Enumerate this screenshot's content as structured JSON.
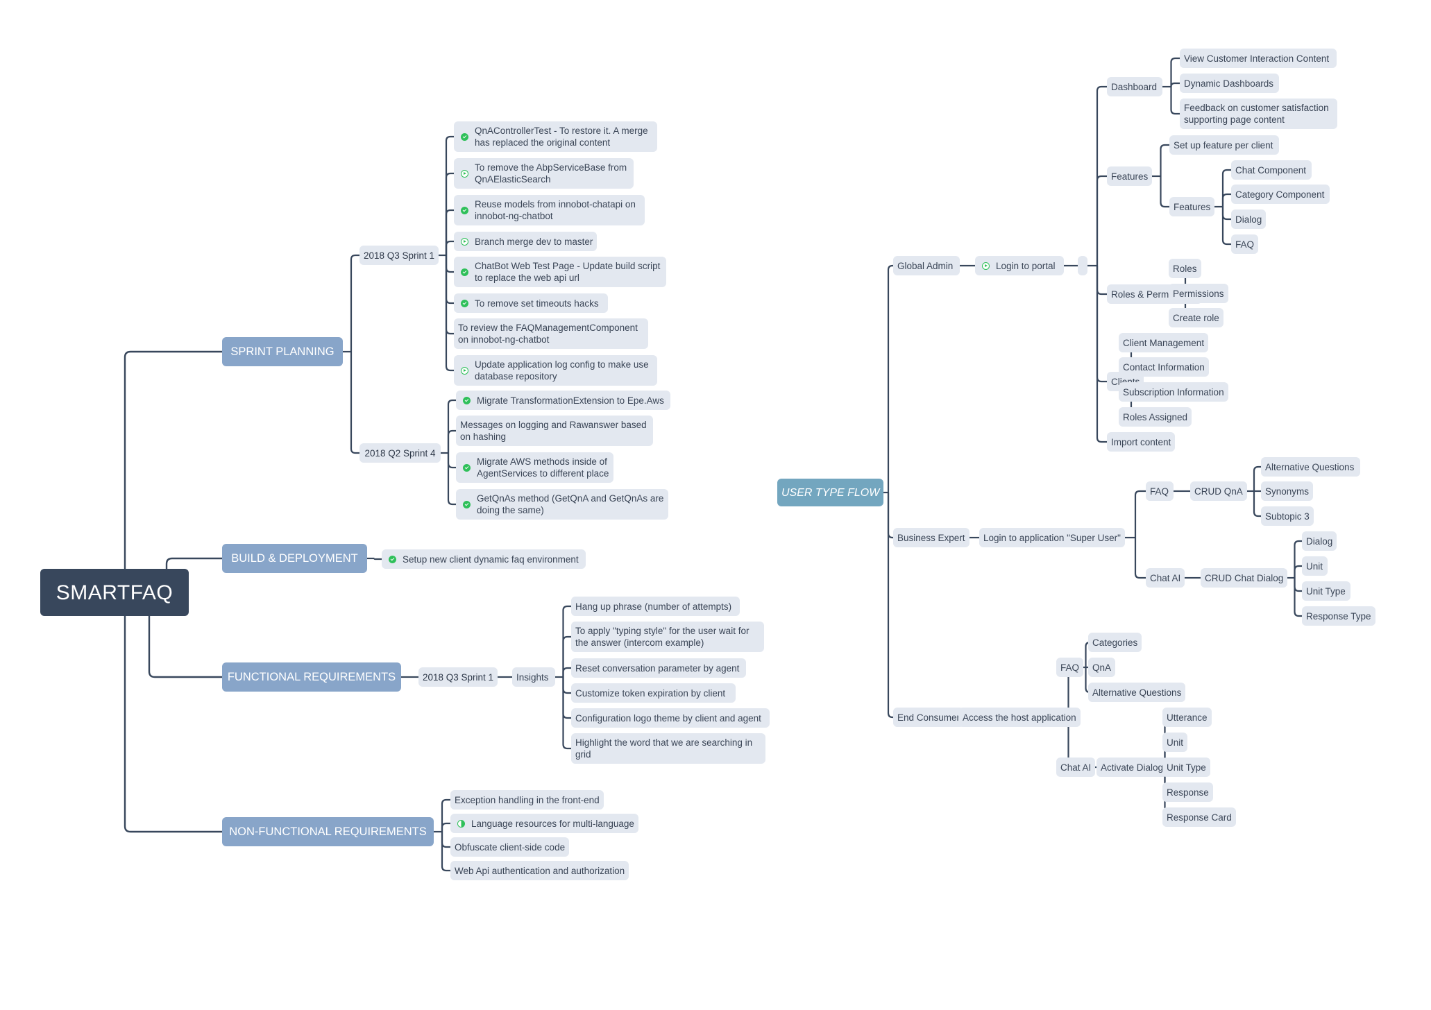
{
  "title": "SMARTFAQ",
  "colors": {
    "line": "#38475c",
    "node_bg": "#e3e8f0",
    "root_bg": "#38475c",
    "main_topic_bg": "#88a5c9",
    "floating_topic_bg": "#73a6bf",
    "done_icon": "#2fc05a"
  },
  "icon_legend": {
    "done": "check-circle-icon",
    "play": "play-circle-icon",
    "half": "half-progress-icon"
  },
  "sprint_planning": {
    "label": "SPRINT PLANNING",
    "q3_sprint1": {
      "label": "2018 Q3 Sprint 1",
      "tasks": [
        {
          "text": "QnAControllerTest - To restore it. A merge\nhas replaced the original content",
          "status": "done"
        },
        {
          "text": "To remove the AbpServiceBase from\nQnAElasticSearch",
          "status": "play"
        },
        {
          "text": "Reuse models from innobot-chatapi on\ninnobot-ng-chatbot",
          "status": "done"
        },
        {
          "text": "Branch merge dev to master",
          "status": "play"
        },
        {
          "text": "ChatBot Web Test Page - Update build script\nto replace the web api url",
          "status": "done"
        },
        {
          "text": "To remove set timeouts hacks",
          "status": "done"
        },
        {
          "text": "To review the FAQManagementComponent\non innobot-ng-chatbot",
          "status": "none"
        },
        {
          "text": "Update application log config to make use\ndatabase repository",
          "status": "play"
        }
      ]
    },
    "q2_sprint4": {
      "label": "2018 Q2 Sprint 4",
      "tasks": [
        {
          "text": "Migrate TransformationExtension to Epe.Aws",
          "status": "done"
        },
        {
          "text": "Messages on logging and Rawanswer based\non hashing",
          "status": "none"
        },
        {
          "text": "Migrate AWS methods inside of\nAgentServices to different place",
          "status": "done"
        },
        {
          "text": "GetQnAs method (GetQnA and GetQnAs are\ndoing the same)",
          "status": "done"
        }
      ]
    }
  },
  "build_deployment": {
    "label": "BUILD & DEPLOYMENT",
    "tasks": [
      {
        "text": "Setup new client dynamic faq environment",
        "status": "done"
      }
    ]
  },
  "functional_requirements": {
    "label": "FUNCTIONAL REQUIREMENTS",
    "sprint": "2018 Q3 Sprint 1",
    "insights": {
      "label": "Insights",
      "items": [
        "Hang up phrase (number of attempts)",
        "To apply \"typing style\" for the user wait for\nthe answer (intercom example)",
        "Reset conversation parameter by agent",
        "Customize token expiration by client",
        "Configuration logo theme by client and agent",
        "Highlight the word that we are searching in\ngrid"
      ]
    }
  },
  "non_functional_requirements": {
    "label": "NON-FUNCTIONAL REQUIREMENTS",
    "tasks": [
      {
        "text": "Exception handling in the front-end",
        "status": "none"
      },
      {
        "text": "Language resources for multi-language",
        "status": "half"
      },
      {
        "text": "Obfuscate client-side code",
        "status": "none"
      },
      {
        "text": "Web Api authentication and authorization",
        "status": "none"
      }
    ]
  },
  "user_type_flow": {
    "label": "USER TYPE FLOW",
    "global_admin": {
      "label": "Global Admin",
      "login": {
        "text": "Login to portal",
        "status": "play"
      },
      "blank": "",
      "dashboard": {
        "label": "Dashboard",
        "items": [
          "View Customer Interaction Content",
          "Dynamic Dashboards",
          "Feedback on customer satisfaction\nsupporting page content"
        ]
      },
      "features": {
        "label": "Features",
        "setup": "Set up feature per client",
        "sub": {
          "label": "Features",
          "items": [
            "Chat Component",
            "Category Component",
            "Dialog",
            "FAQ"
          ]
        }
      },
      "roles": {
        "label": "Roles & Permissions",
        "items": [
          "Roles",
          "Permissions",
          "Create role"
        ]
      },
      "clients": {
        "label": "Clients",
        "items": [
          "Client Management",
          "Contact Information",
          "Subscription Information",
          "Roles Assigned"
        ]
      },
      "import": "Import content"
    },
    "business_expert": {
      "label": "Business Expert",
      "login": "Login to application \"Super User\"",
      "faq": {
        "label": "FAQ",
        "crud": "CRUD QnA",
        "items": [
          "Alternative Questions",
          "Synonyms",
          "Subtopic 3"
        ]
      },
      "chat": {
        "label": "Chat AI",
        "crud": "CRUD Chat Dialog",
        "items": [
          "Dialog",
          "Unit",
          "Unit Type",
          "Response Type"
        ]
      }
    },
    "end_consumer": {
      "label": "End Consumer",
      "access": "Access the host application",
      "faq": {
        "label": "FAQ",
        "items": [
          "Categories",
          "QnA",
          "Alternative Questions"
        ]
      },
      "chat": {
        "label": "Chat AI",
        "activate": "Activate Dialog",
        "items": [
          "Utterance",
          "Unit",
          "Unit Type",
          "Response",
          "Response Card"
        ]
      }
    }
  }
}
